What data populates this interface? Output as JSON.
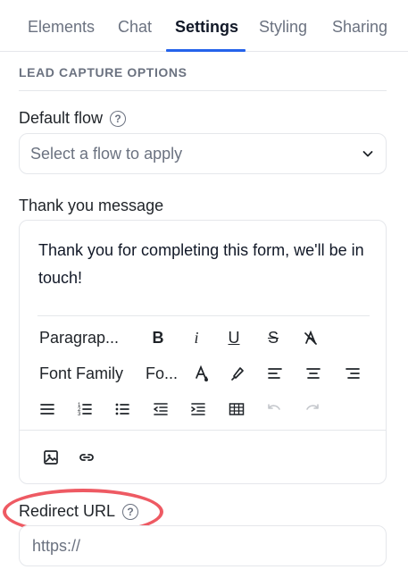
{
  "tabs": [
    {
      "label": "Elements"
    },
    {
      "label": "Chat"
    },
    {
      "label": "Settings"
    },
    {
      "label": "Styling"
    },
    {
      "label": "Sharing"
    }
  ],
  "section": {
    "title": "LEAD CAPTURE OPTIONS"
  },
  "default_flow": {
    "label": "Default flow",
    "select_value": "Select a flow to apply"
  },
  "thank_you": {
    "label": "Thank you message",
    "content": "Thank you for completing this form, we'll be in touch!",
    "toolbar": {
      "paragraph": "Paragrap...",
      "font_family": "Font Family",
      "font_size": "Fo..."
    }
  },
  "redirect": {
    "label": "Redirect URL",
    "placeholder": "https://"
  },
  "colors": {
    "accent": "#2563eb",
    "highlight": "#ee5a63"
  }
}
